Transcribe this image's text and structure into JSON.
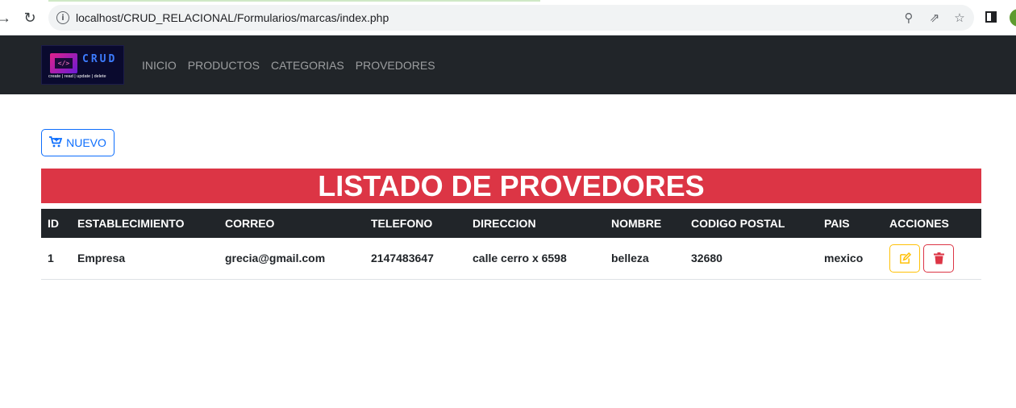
{
  "browser": {
    "url": "localhost/CRUD_RELACIONAL/Formularios/marcas/index.php",
    "back_icon": "arrow-left-icon",
    "reload_icon": "reload-icon"
  },
  "navbar": {
    "logo_word": "CRUD",
    "logo_tag": "create | read | update | delete",
    "links": [
      "INICIO",
      "PRODUCTOS",
      "CATEGORIAS",
      "PROVEDORES"
    ]
  },
  "new_button": {
    "label": "NUEVO",
    "icon": "cart-plus-icon"
  },
  "banner": {
    "title": "LISTADO DE PROVEDORES"
  },
  "table": {
    "headers": [
      "ID",
      "ESTABLECIMIENTO",
      "CORREO",
      "TELEFONO",
      "DIRECCION",
      "NOMBRE",
      "CODIGO POSTAL",
      "PAIS",
      "ACCIONES"
    ],
    "rows": [
      {
        "id": "1",
        "establecimiento": "Empresa",
        "correo": "grecia@gmail.com",
        "telefono": "2147483647",
        "direccion": "calle cerro x 6598",
        "nombre": "belleza",
        "codigo_postal": "32680",
        "pais": "mexico"
      }
    ]
  },
  "colors": {
    "navbar": "#212529",
    "banner": "#dc3545",
    "primary": "#0d6efd",
    "warning": "#ffc107",
    "danger": "#dc3545"
  }
}
